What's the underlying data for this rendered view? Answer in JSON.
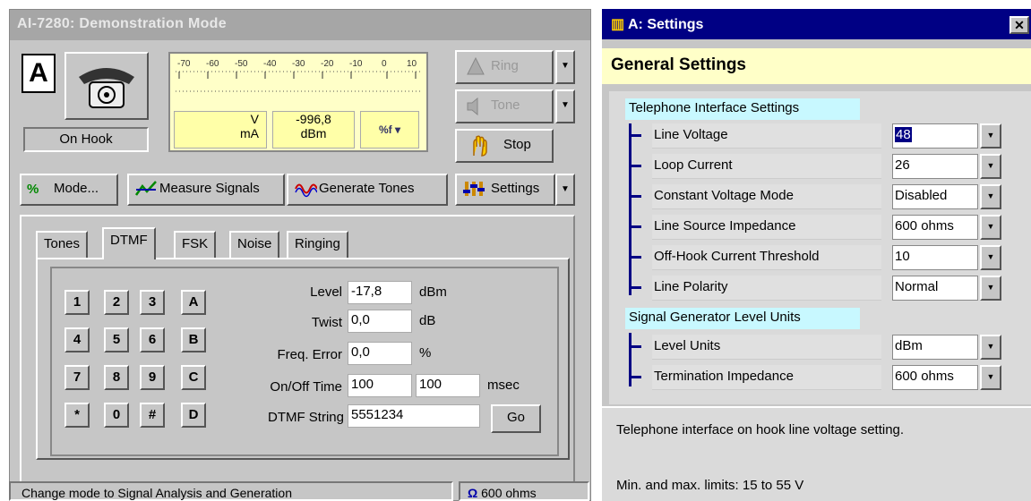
{
  "left_window": {
    "title": "AI-7280:  Demonstration Mode",
    "line_letter": "A",
    "hook_status": "On Hook",
    "meter": {
      "scale_labels": [
        "-70",
        "-60",
        "-50",
        "-40",
        "-30",
        "-20",
        "-10",
        "0",
        "10"
      ],
      "voltage_unit": "V",
      "current_unit": "mA",
      "level_value": "-996,8",
      "level_unit": "dBm",
      "unit_selector": "%f"
    },
    "side_buttons": {
      "ring": "Ring",
      "tone": "Tone",
      "stop": "Stop"
    },
    "toolbar": {
      "mode": "Mode...",
      "measure": "Measure Signals",
      "generate": "Generate Tones",
      "settings": "Settings"
    },
    "tabs": [
      "Tones",
      "DTMF",
      "FSK",
      "Noise",
      "Ringing"
    ],
    "active_tab": "DTMF",
    "keypad": [
      [
        "1",
        "2",
        "3",
        "A"
      ],
      [
        "4",
        "5",
        "6",
        "B"
      ],
      [
        "7",
        "8",
        "9",
        "C"
      ],
      [
        "*",
        "0",
        "#",
        "D"
      ]
    ],
    "fields": {
      "level_label": "Level",
      "level_value": "-17,8",
      "level_unit": "dBm",
      "twist_label": "Twist",
      "twist_value": "0,0",
      "twist_unit": "dB",
      "freq_label": "Freq. Error",
      "freq_value": "0,0",
      "freq_unit": "%",
      "onoff_label": "On/Off Time",
      "on_value": "100",
      "off_value": "100",
      "onoff_unit": "msec",
      "dtmf_label": "DTMF String",
      "dtmf_value": "5551234"
    },
    "go_button": "Go",
    "status_text": "Change mode to Signal Analysis and Generation",
    "status_impedance": "600 ohms"
  },
  "right_window": {
    "title": "A:  Settings",
    "close": "✕",
    "header": "General Settings",
    "section1_title": "Telephone Interface Settings",
    "section1_items": [
      {
        "label": "Line Voltage",
        "value": "48"
      },
      {
        "label": "Loop Current",
        "value": "26"
      },
      {
        "label": "Constant Voltage Mode",
        "value": "Disabled"
      },
      {
        "label": "Line Source Impedance",
        "value": "600 ohms"
      },
      {
        "label": "Off-Hook Current Threshold",
        "value": "10"
      },
      {
        "label": "Line Polarity",
        "value": "Normal"
      }
    ],
    "section2_title": "Signal Generator Level Units",
    "section2_items": [
      {
        "label": "Level Units",
        "value": "dBm"
      },
      {
        "label": "Termination Impedance",
        "value": "600 ohms"
      }
    ],
    "description": "Telephone interface on hook line voltage setting.",
    "limits": "Min. and max. limits: 15 to 55 V"
  }
}
